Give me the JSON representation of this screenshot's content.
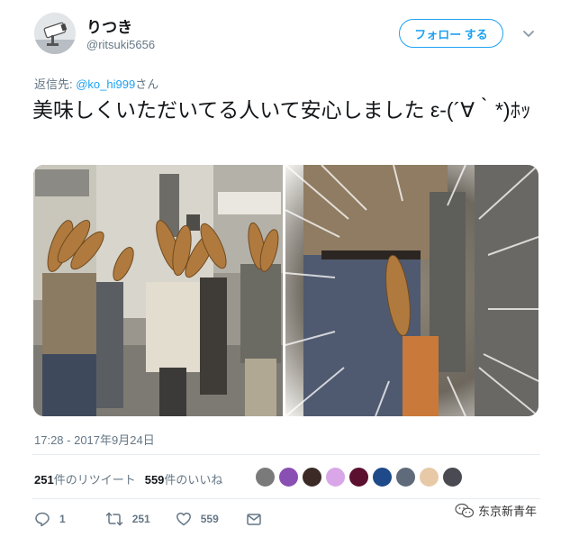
{
  "user": {
    "display_name": "りつき",
    "handle": "@ritsuki5656",
    "avatar_icon": "cctv-camera-avatar"
  },
  "follow_button": {
    "label": "フォロー する"
  },
  "menu_icon": "chevron-down-icon",
  "reply": {
    "prefix": "返信先: ",
    "mention": "@ko_hi999",
    "suffix": "さん"
  },
  "tweet": {
    "text": "美味しくいただいてる人いて安心しました ε-(´∀｀*)ﾎｯ"
  },
  "photos": [
    {
      "description_icon": "photo-baguette-people-street"
    },
    {
      "description_icon": "photo-baguette-closeup"
    }
  ],
  "timestamp": "17:28 - 2017年9月24日",
  "stats": {
    "retweets_count": "251",
    "retweets_label": "件のリツイート",
    "likes_count": "559",
    "likes_label": "件のいいね"
  },
  "liker_avatars": [
    {
      "name": "liker-avatar-1",
      "color": "#7a7a7a"
    },
    {
      "name": "liker-avatar-2",
      "color": "#8a4fb3"
    },
    {
      "name": "liker-avatar-3",
      "color": "#3b2a25"
    },
    {
      "name": "liker-avatar-4",
      "color": "#d9a7e8"
    },
    {
      "name": "liker-avatar-5",
      "color": "#5b1030"
    },
    {
      "name": "liker-avatar-6",
      "color": "#1f4a8a"
    },
    {
      "name": "liker-avatar-7",
      "color": "#5f6b7a"
    },
    {
      "name": "liker-avatar-8",
      "color": "#e7c9a8"
    },
    {
      "name": "liker-avatar-9",
      "color": "#4a4a52"
    }
  ],
  "actions": {
    "reply_count": "1",
    "retweet_count": "251",
    "like_count": "559"
  },
  "watermark": {
    "text": "东京新青年"
  },
  "colors": {
    "accent": "#1da1f2",
    "secondary_text": "#657786",
    "primary_text": "#14171a",
    "divider": "#e6ecf0"
  }
}
